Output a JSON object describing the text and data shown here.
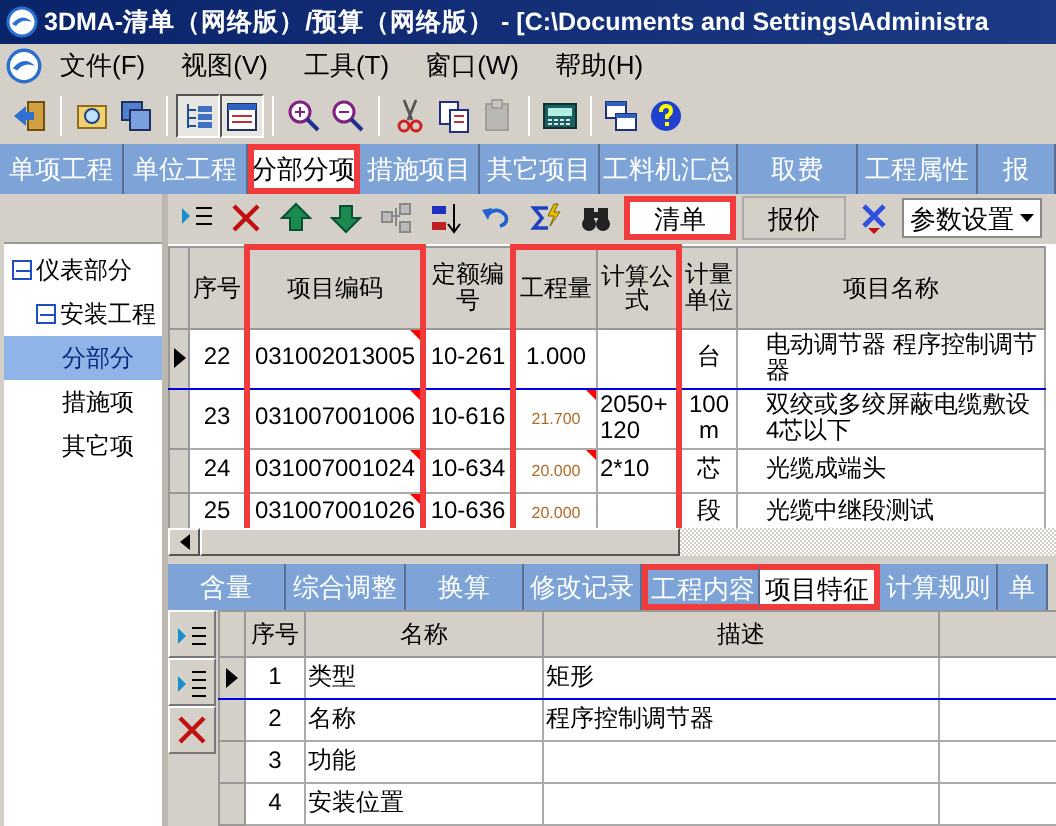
{
  "window": {
    "title": "3DMA-清单（网络版）/预算（网络版） - [C:\\Documents and Settings\\Administra"
  },
  "menu": [
    "文件(F)",
    "视图(V)",
    "工具(T)",
    "窗口(W)",
    "帮助(H)"
  ],
  "toolbar": [
    {
      "pressed": false,
      "disabled": false
    },
    {
      "pressed": false,
      "disabled": false
    },
    {
      "pressed": false,
      "disabled": false
    },
    {
      "pressed": true,
      "disabled": false
    },
    {
      "pressed": true,
      "disabled": false
    },
    {
      "pressed": false,
      "disabled": false
    },
    {
      "pressed": false,
      "disabled": false
    },
    {
      "pressed": false,
      "disabled": false
    },
    {
      "pressed": false,
      "disabled": false
    },
    {
      "pressed": false,
      "disabled": true
    },
    {
      "pressed": false,
      "disabled": false
    },
    {
      "pressed": false,
      "disabled": false
    },
    {
      "pressed": false,
      "disabled": false
    }
  ],
  "main_tabs": [
    {
      "label": "单项工程",
      "selected": false
    },
    {
      "label": "单位工程",
      "selected": false
    },
    {
      "label": "分部分项",
      "selected": true
    },
    {
      "label": "措施项目",
      "selected": false
    },
    {
      "label": "其它项目",
      "selected": false
    },
    {
      "label": "工料机汇总",
      "selected": false
    },
    {
      "label": "取费",
      "selected": false
    },
    {
      "label": "工程属性",
      "selected": false
    },
    {
      "label": "报",
      "selected": false
    }
  ],
  "tree": [
    {
      "label": "仪表部分",
      "expanded": true,
      "selected": false,
      "children": [
        {
          "label": "安装工程",
          "expanded": true,
          "selected": false,
          "children": [
            {
              "label": "分部分",
              "selected": true
            },
            {
              "label": "措施项",
              "selected": false
            },
            {
              "label": "其它项",
              "selected": false
            }
          ]
        }
      ]
    }
  ],
  "list_toolbar": {
    "views": [
      {
        "label": "清单",
        "selected": true
      },
      {
        "label": "报价",
        "selected": false
      }
    ],
    "settings_dropdown": "参数设置"
  },
  "items_table": {
    "columns": [
      {
        "label": "序号",
        "highlighted": false
      },
      {
        "label": "项目编码",
        "highlighted": true
      },
      {
        "label": "定额编号",
        "highlighted": false
      },
      {
        "label": "工程量",
        "highlighted": true
      },
      {
        "label": "计算公式",
        "highlighted": true
      },
      {
        "label": "计量单位",
        "highlighted": false
      },
      {
        "label": "项目名称",
        "highlighted": false
      }
    ],
    "rows": [
      {
        "selected": true,
        "number": "22",
        "code": "031002013005",
        "code_marked": true,
        "quota": "10-261",
        "quantity": "1.000",
        "quantity_marked": false,
        "quantity_derived": false,
        "unit": "台",
        "name": "电动调节器 程序控制调节器"
      },
      {
        "selected": false,
        "number": "23",
        "code": "031007001006",
        "code_marked": true,
        "quota": "10-616",
        "quantity": "21.700",
        "quantity_marked": true,
        "quantity_derived": true,
        "formula": "2050+120",
        "unit": "100 m",
        "name": "双绞或多绞屏蔽电缆敷设4芯以下"
      },
      {
        "selected": false,
        "number": "24",
        "code": "031007001024",
        "code_marked": true,
        "quota": "10-634",
        "quantity": "20.000",
        "quantity_marked": true,
        "quantity_derived": true,
        "formula": "2*10",
        "unit": "芯",
        "name": "光缆成端头"
      },
      {
        "selected": false,
        "number": "25",
        "code": "031007001026",
        "code_marked": true,
        "quota": "10-636",
        "quantity": "20.000",
        "quantity_marked": false,
        "quantity_derived": true,
        "unit": "段",
        "name": "光缆中继段测试"
      }
    ]
  },
  "detail_tabs": [
    {
      "label": "含量",
      "selected": false,
      "highlighted": false
    },
    {
      "label": "综合调整",
      "selected": false,
      "highlighted": false
    },
    {
      "label": "换算",
      "selected": false,
      "highlighted": false
    },
    {
      "label": "修改记录",
      "selected": false,
      "highlighted": false
    },
    {
      "label": "工程内容",
      "selected": false,
      "highlighted": true
    },
    {
      "label": "项目特征",
      "selected": true,
      "highlighted": true
    },
    {
      "label": "计算规则",
      "selected": false,
      "highlighted": false
    },
    {
      "label": "单",
      "selected": false,
      "highlighted": false
    }
  ],
  "features_table": {
    "columns": [
      "序号",
      "名称",
      "描述"
    ],
    "rows": [
      {
        "selected": true,
        "number": "1",
        "name": "类型",
        "description": "矩形"
      },
      {
        "selected": false,
        "number": "2",
        "name": "名称",
        "description": "程序控制调节器"
      },
      {
        "selected": false,
        "number": "3",
        "name": "功能"
      },
      {
        "selected": false,
        "number": "4",
        "name": "安装位置"
      }
    ]
  }
}
